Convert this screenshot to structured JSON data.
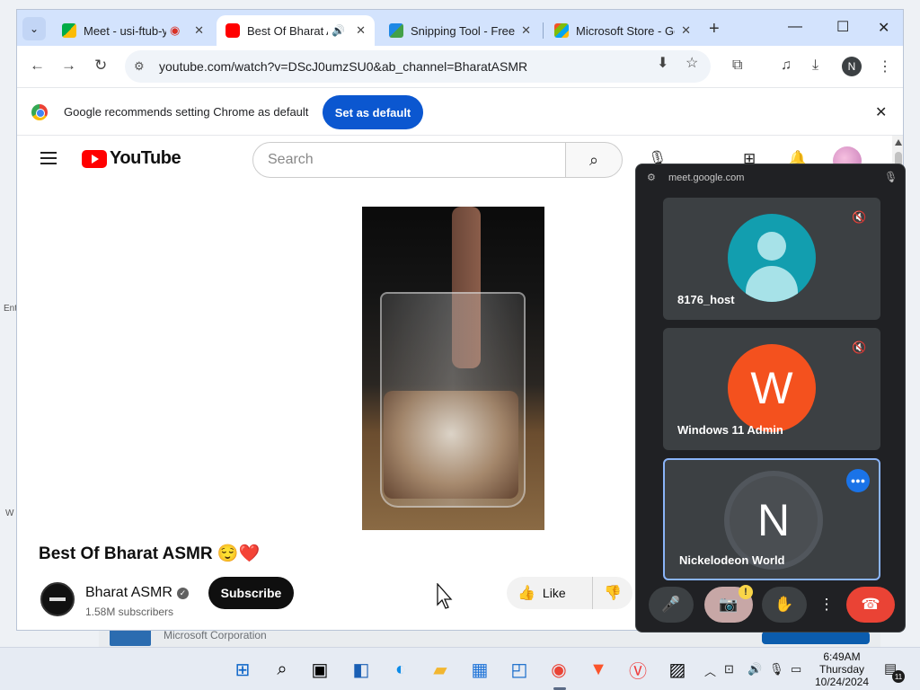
{
  "browser": {
    "tabs": [
      {
        "title": "Meet - usi-ftub-y",
        "favicon": "google-meet-icon",
        "recording": true
      },
      {
        "title": "Best Of Bharat A",
        "favicon": "youtube-icon",
        "audio": true,
        "active": true
      },
      {
        "title": "Snipping Tool - Free",
        "favicon": "microsoft-store-icon"
      },
      {
        "title": "Microsoft Store - Ge",
        "favicon": "microsoft-store-icon"
      }
    ],
    "url": "youtube.com/watch?v=DScJ0umzSU0&ab_channel=BharatASMR",
    "profile_initial": "N",
    "infobar": {
      "message": "Google recommends setting Chrome as default",
      "button": "Set as default"
    }
  },
  "youtube": {
    "logo_text": "YouTube",
    "search_placeholder": "Search",
    "video_title": "Best Of Bharat ASMR 😌❤️",
    "channel_name": "Bharat ASMR",
    "subscribers": "1.58M subscribers",
    "subscribe_label": "Subscribe",
    "like_label": "Like"
  },
  "meet": {
    "url": "meet.google.com",
    "participants": [
      {
        "name": "8176_host",
        "initial": "",
        "avatar_color": "#129eaf",
        "muted": true
      },
      {
        "name": "Windows 11 Admin",
        "initial": "W",
        "avatar_color": "#f4511e",
        "muted": true
      },
      {
        "name": "Nickelodeon World",
        "initial": "N",
        "avatar_color": "#4a4e52",
        "speaking": true
      }
    ]
  },
  "behind_window": {
    "publisher": "Microsoft Corporation"
  },
  "desktop_labels": {
    "left_1": "Ent",
    "left_2": "W"
  },
  "taskbar": {
    "time": "6:49AM",
    "day": "Thursday",
    "date": "10/24/2024",
    "notification_count": "11"
  }
}
